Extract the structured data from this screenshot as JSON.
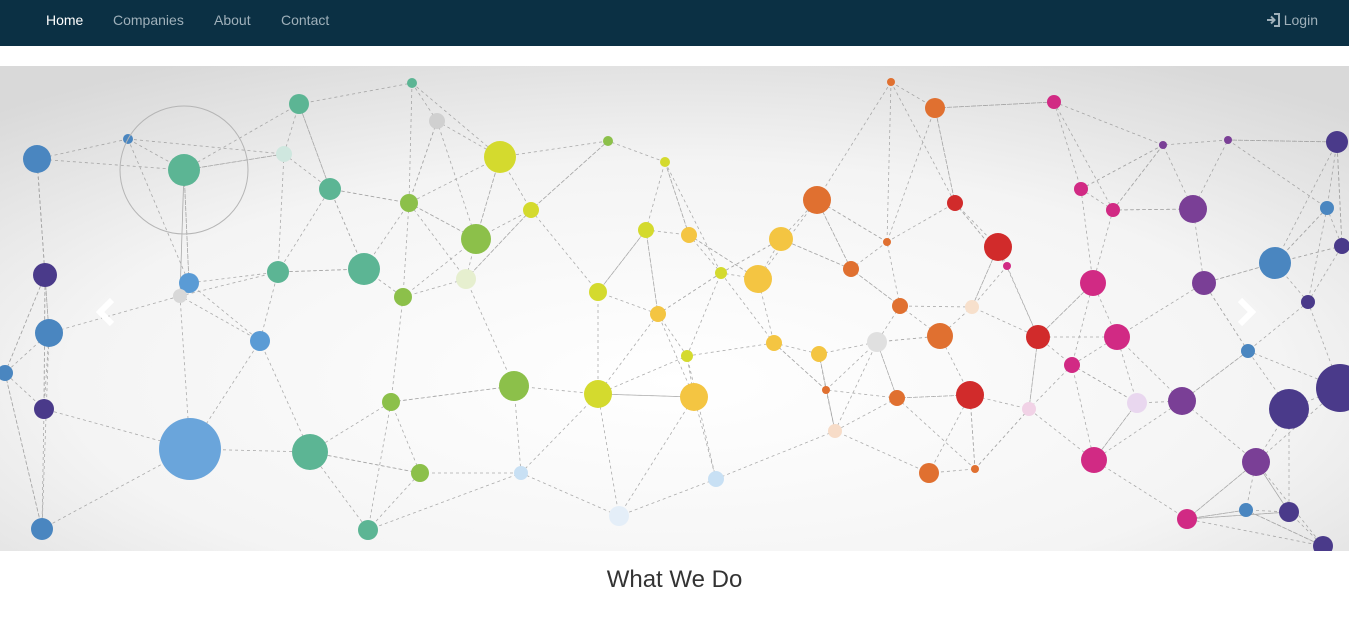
{
  "nav": {
    "items": [
      {
        "label": "Home",
        "active": true
      },
      {
        "label": "Companies",
        "active": false
      },
      {
        "label": "About",
        "active": false
      },
      {
        "label": "Contact",
        "active": false
      }
    ],
    "login_label": "Login",
    "login_icon": "sign-in-icon"
  },
  "carousel": {
    "prev_icon": "chevron-left-icon",
    "next_icon": "chevron-right-icon",
    "image": "network-graph-illustration"
  },
  "section": {
    "title": "What We Do"
  },
  "colors": {
    "navbar_bg": "#0b3044",
    "nav_text": "#9fb0ba",
    "nav_active": "#ffffff",
    "heading_text": "#333333"
  }
}
